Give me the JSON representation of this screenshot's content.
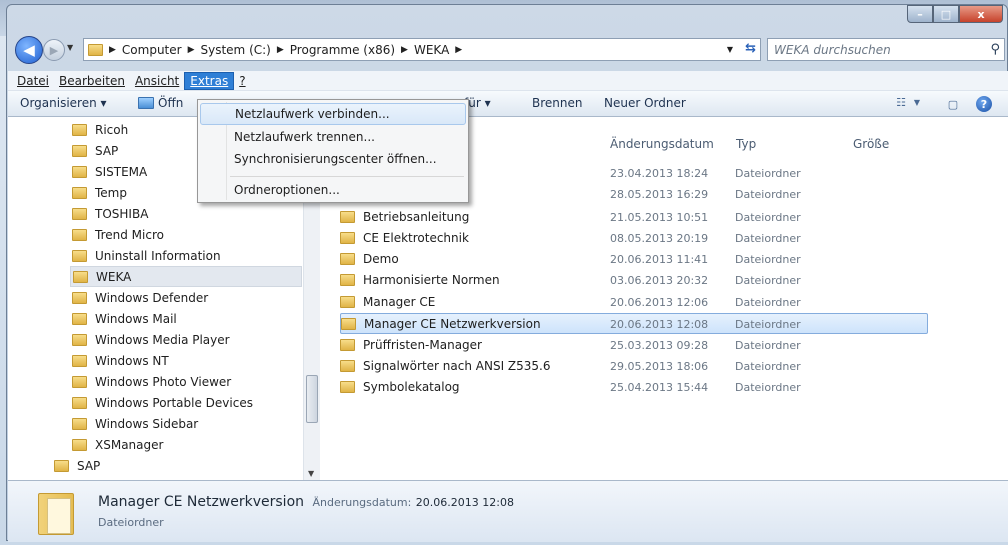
{
  "window": {
    "caption": {
      "minimize": "–",
      "maximize": "□",
      "close": "x"
    }
  },
  "address": {
    "crumbs": [
      "Computer",
      "System (C:)",
      "Programme (x86)",
      "WEKA"
    ],
    "search_placeholder": "WEKA durchsuchen"
  },
  "menubar": [
    "Datei",
    "Bearbeiten",
    "Ansicht",
    "Extras",
    "?"
  ],
  "toolbar": {
    "organize": "Organisieren ▾",
    "open": "Öffn",
    "share": "für ▾",
    "burn": "Brennen",
    "new_folder": "Neuer Ordner"
  },
  "extras_menu": {
    "items": [
      "Netzlaufwerk verbinden...",
      "Netzlaufwerk trennen...",
      "Synchronisierungscenter öffnen...",
      "Ordneroptionen..."
    ]
  },
  "navpane": {
    "items": [
      "Ricoh",
      "SAP",
      "SISTEMA",
      "Temp",
      "TOSHIBA",
      "Trend Micro",
      "Uninstall Information",
      "WEKA",
      "Windows Defender",
      "Windows Mail",
      "Windows Media Player",
      "Windows NT",
      "Windows Photo Viewer",
      "Windows Portable Devices",
      "Windows Sidebar",
      "XSManager",
      "SAP"
    ],
    "selected": "WEKA"
  },
  "columns": {
    "date": "Änderungsdatum",
    "type": "Typ",
    "size": "Größe"
  },
  "files": [
    {
      "name": "",
      "date": "23.04.2013 18:24",
      "type": "Dateiordner"
    },
    {
      "name": "",
      "date": "28.05.2013 16:29",
      "type": "Dateiordner"
    },
    {
      "name": "Betriebsanleitung",
      "date": "21.05.2013 10:51",
      "type": "Dateiordner"
    },
    {
      "name": "CE Elektrotechnik",
      "date": "08.05.2013 20:19",
      "type": "Dateiordner"
    },
    {
      "name": "Demo",
      "date": "20.06.2013 11:41",
      "type": "Dateiordner"
    },
    {
      "name": "Harmonisierte Normen",
      "date": "03.06.2013 20:32",
      "type": "Dateiordner"
    },
    {
      "name": "Manager CE",
      "date": "20.06.2013 12:06",
      "type": "Dateiordner"
    },
    {
      "name": "Manager CE Netzwerkversion",
      "date": "20.06.2013 12:08",
      "type": "Dateiordner"
    },
    {
      "name": "Prüffristen-Manager",
      "date": "25.03.2013 09:28",
      "type": "Dateiordner"
    },
    {
      "name": "Signalwörter nach ANSI Z535.6",
      "date": "29.05.2013 18:06",
      "type": "Dateiordner"
    },
    {
      "name": "Symbolekatalog",
      "date": "25.04.2013 15:44",
      "type": "Dateiordner"
    }
  ],
  "details": {
    "name": "Manager CE Netzwerkversion",
    "date_label": "Änderungsdatum:",
    "date_value": "20.06.2013 12:08",
    "type": "Dateiordner"
  },
  "colors": {
    "menu_active": "#2f7fd6",
    "selection_border": "#84acdd"
  }
}
